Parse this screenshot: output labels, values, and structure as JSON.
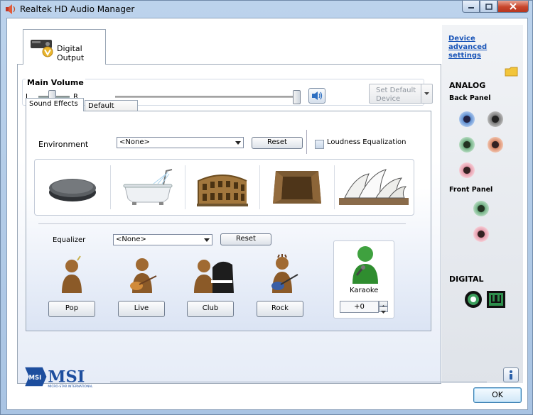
{
  "window": {
    "title": "Realtek HD Audio Manager"
  },
  "device_tab": {
    "label": "Digital Output"
  },
  "main_volume": {
    "title": "Main Volume",
    "left_label": "L",
    "right_label": "R",
    "balance_level": 0.5,
    "volume_level": 1.0
  },
  "set_default": {
    "label": "Set Default Device"
  },
  "subtabs": {
    "sound_effects": "Sound Effects",
    "default_format": "Default Format"
  },
  "environment": {
    "label": "Environment",
    "selected": "<None>",
    "reset_label": "Reset",
    "loudness_label": "Loudness Equalization",
    "loudness_checked": false,
    "presets": [
      "stone-disc-icon",
      "bathtub-icon",
      "colosseum-icon",
      "stone-room-icon",
      "opera-house-icon"
    ]
  },
  "equalizer": {
    "label": "Equalizer",
    "selected": "<None>",
    "reset_label": "Reset",
    "presets": [
      {
        "label": "Pop",
        "icon": "pop-singer-icon"
      },
      {
        "label": "Live",
        "icon": "guitarist-icon"
      },
      {
        "label": "Club",
        "icon": "pianist-icon"
      },
      {
        "label": "Rock",
        "icon": "rock-guitarist-icon"
      }
    ]
  },
  "karaoke": {
    "label": "Karaoke",
    "value": "+0"
  },
  "side": {
    "advanced_link": "Device advanced settings",
    "analog_title": "ANALOG",
    "back_panel_label": "Back Panel",
    "front_panel_label": "Front Panel",
    "digital_title": "DIGITAL",
    "colors": {
      "blue": "#5f8fd0",
      "grey": "#7a7a7a",
      "green": "#6fae82",
      "orange": "#d98a6a",
      "pink": "#e49aaa"
    }
  },
  "footer": {
    "brand": "MSI",
    "brand_sub": "MICRO-STAR INTERNATIONAL",
    "ok_label": "OK"
  }
}
